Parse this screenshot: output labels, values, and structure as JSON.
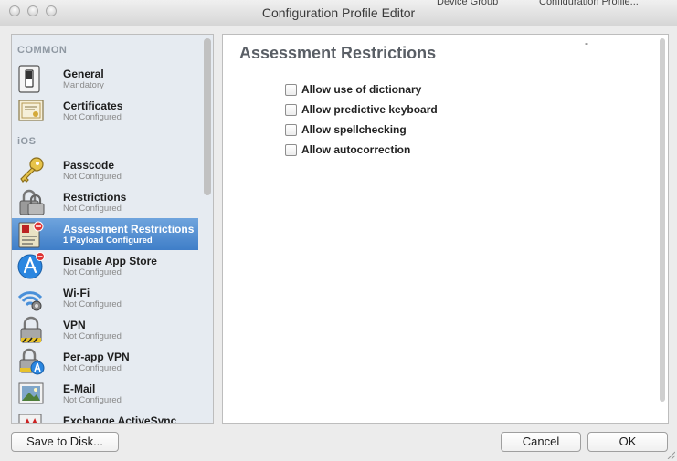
{
  "window": {
    "title": "Configuration Profile Editor"
  },
  "background_text": {
    "left": "Device Group",
    "right": "Configuration Profile..."
  },
  "sidebar": {
    "sections": [
      {
        "header": "COMMON"
      },
      {
        "header": "iOS"
      }
    ],
    "items": [
      {
        "name": "General",
        "status": "Mandatory",
        "icon": "switch-icon"
      },
      {
        "name": "Certificates",
        "status": "Not Configured",
        "icon": "certificate-icon"
      },
      {
        "name": "Passcode",
        "status": "Not Configured",
        "icon": "key-icon"
      },
      {
        "name": "Restrictions",
        "status": "Not Configured",
        "icon": "padlock-icon"
      },
      {
        "name": "Assessment Restrictions",
        "status": "1 Payload Configured",
        "icon": "assessment-icon",
        "selected": true
      },
      {
        "name": "Disable App Store",
        "status": "Not Configured",
        "icon": "app-store-icon"
      },
      {
        "name": "Wi-Fi",
        "status": "Not Configured",
        "icon": "wifi-icon"
      },
      {
        "name": "VPN",
        "status": "Not Configured",
        "icon": "vpn-lock-icon"
      },
      {
        "name": "Per-app VPN",
        "status": "Not Configured",
        "icon": "per-app-vpn-icon"
      },
      {
        "name": "E-Mail",
        "status": "Not Configured",
        "icon": "email-icon"
      },
      {
        "name": "Exchange ActiveSync",
        "status": "",
        "icon": "exchange-icon"
      }
    ]
  },
  "main": {
    "title": "Assessment Restrictions",
    "dash": "-",
    "options": [
      {
        "label": "Allow use of dictionary",
        "checked": false
      },
      {
        "label": "Allow predictive keyboard",
        "checked": false
      },
      {
        "label": "Allow spellchecking",
        "checked": false
      },
      {
        "label": "Allow autocorrection",
        "checked": false
      }
    ]
  },
  "buttons": {
    "save": "Save to Disk...",
    "cancel": "Cancel",
    "ok": "OK"
  },
  "colors": {
    "selection": "#3f7ec8",
    "sidebar_bg": "#e6ebf1"
  }
}
